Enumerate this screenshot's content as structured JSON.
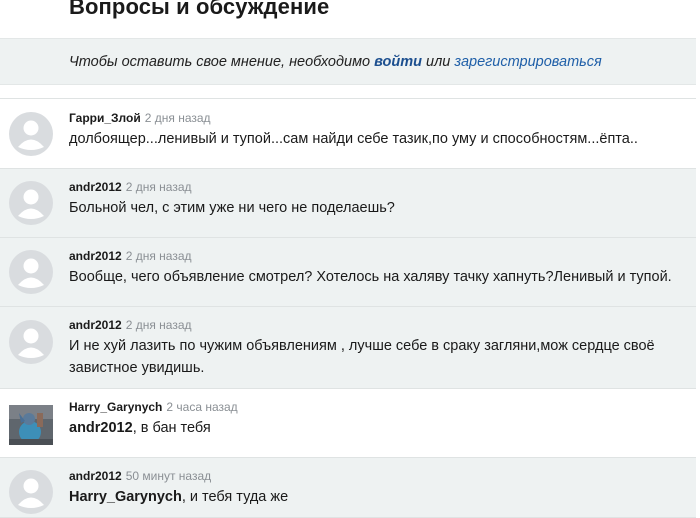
{
  "page": {
    "title": "Вопросы и обсуждение"
  },
  "notice": {
    "prefix": "Чтобы оставить свое мнение, необходимо",
    "login_label": "войти",
    "or": "или",
    "register_label": "зарегистрироваться"
  },
  "colors": {
    "row_alt": "#eef2f2",
    "link": "#1f5fa8",
    "time": "#8a8f94"
  },
  "comments": [
    {
      "author": "Гарри_Злой",
      "time": "2 дня назад",
      "avatar": "default-avatar-icon",
      "text": "долбоящер...ленивый и тупой...сам найди себе тазик,по уму и способностям...ёпта.."
    },
    {
      "author": "andr2012",
      "time": "2 дня назад",
      "avatar": "default-avatar-icon",
      "text": "Больной чел, с этим уже ни чего не поделаешь?"
    },
    {
      "author": "andr2012",
      "time": "2 дня назад",
      "avatar": "default-avatar-icon",
      "text": "Вообще, чего объявление смотрел? Хотелось на халяву тачку хапнуть?Ленивый и тупой."
    },
    {
      "author": "andr2012",
      "time": "2 дня назад",
      "avatar": "default-avatar-icon",
      "text": "И не хуй лазить по чужим объявлениям , лучше себе в сраку загляни,мож сердце своё завистное увидишь."
    },
    {
      "author": "Harry_Garynych",
      "time": "2 часа назад",
      "avatar": "user-photo",
      "mention": "andr2012",
      "text": ", в бан тебя"
    },
    {
      "author": "andr2012",
      "time": "50 минут назад",
      "avatar": "default-avatar-icon",
      "mention": "Harry_Garynych",
      "text": ", и тебя туда же"
    }
  ]
}
